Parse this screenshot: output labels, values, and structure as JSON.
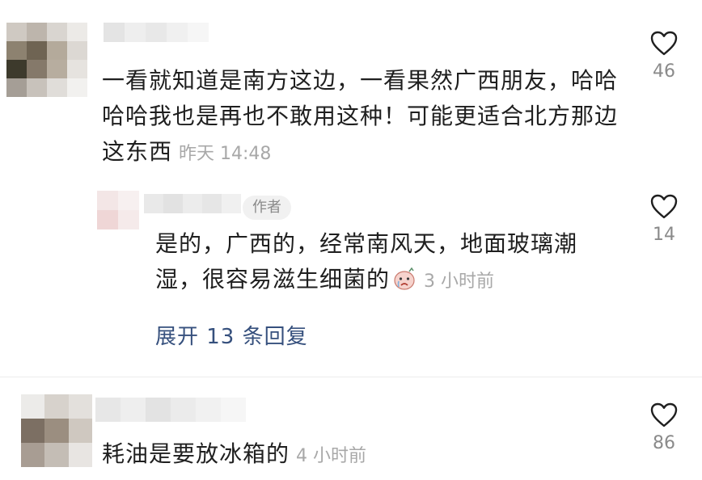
{
  "comments": [
    {
      "text": "一看就知道是南方这边，一看果然广西朋友，哈哈哈哈我也是再也不敢用这种！可能更适合北方那边这东西",
      "time": "昨天 14:48",
      "likes": "46",
      "reply": {
        "badge": "作者",
        "text": "是的，广西的，经常南风天，地面玻璃潮湿，很容易滋生细菌的",
        "time": "3 小时前",
        "likes": "14",
        "emoji_icon": "sad-face-emoji-icon"
      },
      "expand_label": "展开 13 条回复"
    },
    {
      "text": "耗油是要放冰箱的",
      "time": "4 小时前",
      "likes": "86"
    }
  ],
  "colors": {
    "text": "#1f1f1f",
    "muted": "#a8a8a8",
    "link": "#36507d",
    "badge_bg": "#f1f1f1"
  }
}
